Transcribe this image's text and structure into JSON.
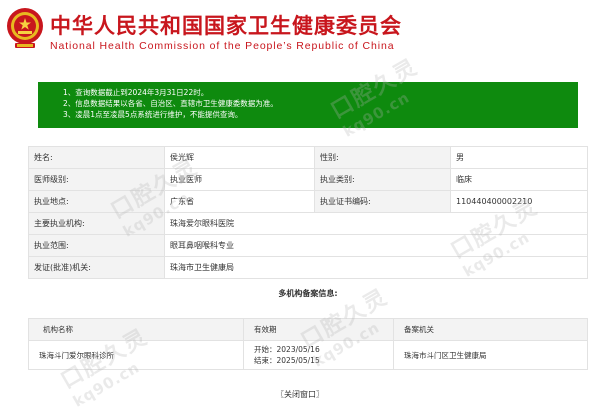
{
  "header": {
    "title_cn": "中华人民共和国国家卫生健康委员会",
    "title_en": "National Health Commission of the People’s Republic of China",
    "emblem_icon": "national-emblem-icon",
    "brand_color": "#c8161d"
  },
  "notice": {
    "bg_color": "#0e8a0e",
    "lines": [
      "1、查询数据截止到2024年3月31日22时。",
      "2、信息数据结果以各省、自治区、直辖市卫生健康委数据为准。",
      "3、凌晨1点至凌晨5点系统进行维护，不能提供查询。"
    ]
  },
  "info": {
    "name_label": "姓名:",
    "name": "侯光辉",
    "gender_label": "性别:",
    "gender": "男",
    "level_label": "医师级别:",
    "level": "执业医师",
    "category_label": "执业类别:",
    "category": "临床",
    "place_label": "执业地点:",
    "place": "广东省",
    "cert_label": "执业证书编码:",
    "cert": "110440400002210",
    "org_label": "主要执业机构:",
    "org": "珠海爱尔眼科医院",
    "scope_label": "执业范围:",
    "scope": "眼耳鼻咽喉科专业",
    "issuer_label": "发证(批准)机关:",
    "issuer": "珠海市卫生健康局"
  },
  "multi": {
    "title": "多机构备案信息:",
    "col_org": "机构名称",
    "col_valid": "有效期",
    "col_authority": "备案机关",
    "rows": [
      {
        "org": "珠海斗门爱尔眼科诊所",
        "start": "开始：2023/05/16",
        "end": "结束：2025/05/15",
        "authority": "珠海市斗门区卫生健康局"
      }
    ]
  },
  "close_label": "〖关闭窗口〗",
  "watermark": {
    "text": "口腔久灵",
    "url": "kq90.cn"
  }
}
